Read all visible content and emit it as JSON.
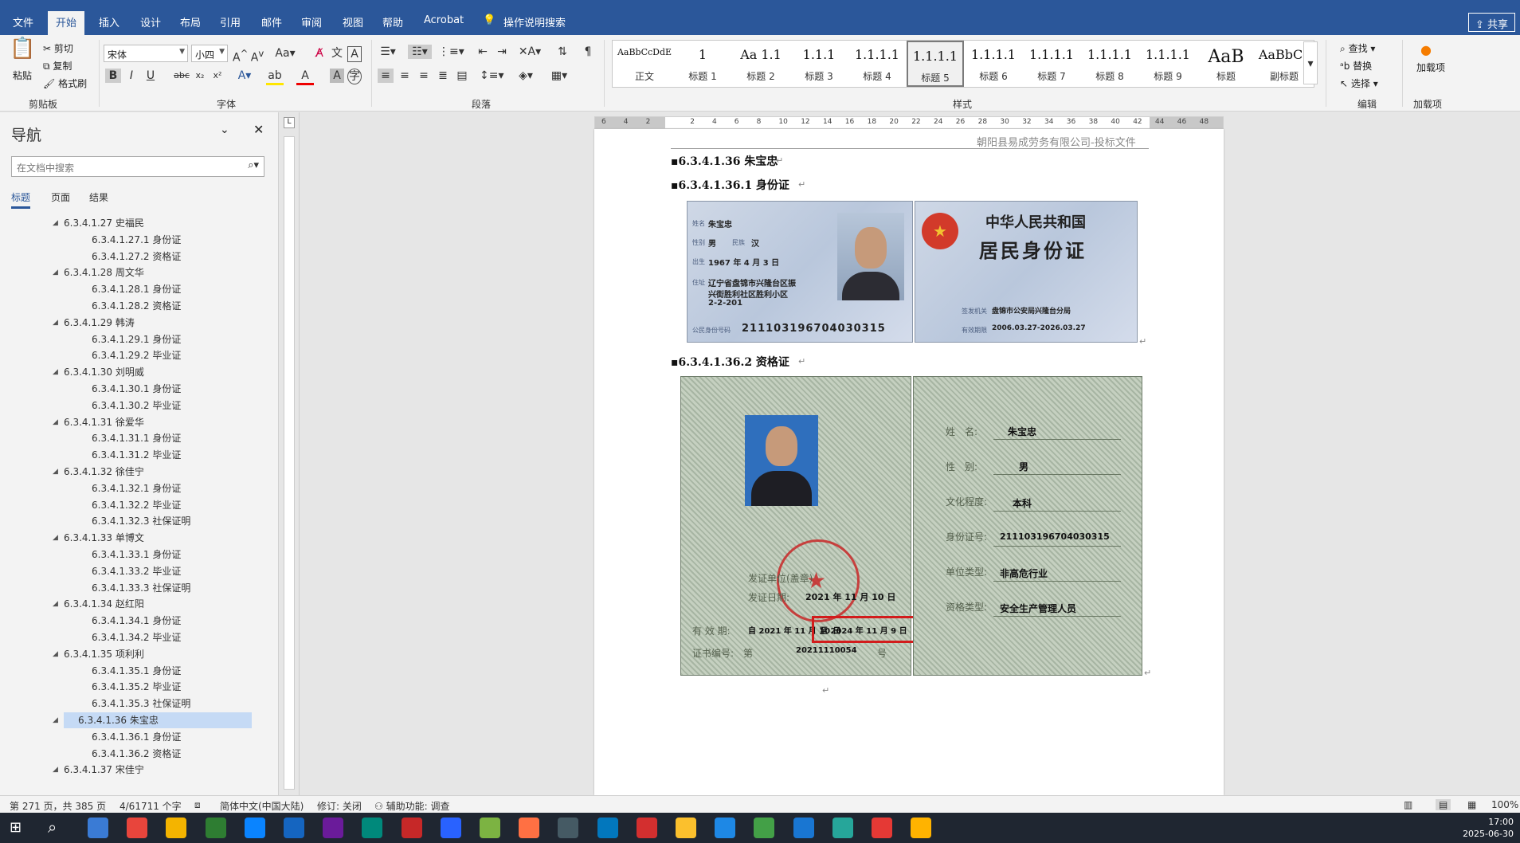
{
  "ribbon_tabs": [
    "文件",
    "开始",
    "插入",
    "设计",
    "布局",
    "引用",
    "邮件",
    "审阅",
    "视图",
    "帮助",
    "Acrobat"
  ],
  "active_tab": "开始",
  "tell_me": "操作说明搜索",
  "share": "共享",
  "clipboard": {
    "paste": "粘贴",
    "cut": "剪切",
    "copy": "复制",
    "format_painter": "格式刷",
    "group": "剪贴板"
  },
  "font": {
    "name": "宋体",
    "size": "小四",
    "group": "字体"
  },
  "paragraph_group": "段落",
  "styles": {
    "group": "样式",
    "items": [
      {
        "preview": "AaBbCcDdE",
        "name": "正文"
      },
      {
        "preview": "1",
        "name": "标题 1"
      },
      {
        "preview": "Aa 1.1",
        "name": "标题 2"
      },
      {
        "preview": "1.1.1",
        "name": "标题 3"
      },
      {
        "preview": "1.1.1.1",
        "name": "标题 4"
      },
      {
        "preview": "1.1.1.1",
        "name": "标题 5"
      },
      {
        "preview": "1.1.1.1",
        "name": "标题 6"
      },
      {
        "preview": "1.1.1.1",
        "name": "标题 7"
      },
      {
        "preview": "1.1.1.1",
        "name": "标题 8"
      },
      {
        "preview": "1.1.1.1",
        "name": "标题 9"
      },
      {
        "preview": "AaB",
        "name": "标题"
      },
      {
        "preview": "AaBbCc",
        "name": "副标题"
      }
    ],
    "selected": 5
  },
  "editing": {
    "find": "查找",
    "replace": "替换",
    "select": "选择",
    "group": "编辑"
  },
  "addins": {
    "label": "加载项",
    "group": "加载项"
  },
  "nav": {
    "title": "导航",
    "search_placeholder": "在文档中搜索",
    "tabs": [
      "标题",
      "页面",
      "结果"
    ],
    "items": [
      {
        "level": 4,
        "text": "6.3.4.1.27 史福民"
      },
      {
        "level": 5,
        "text": "6.3.4.1.27.1 身份证"
      },
      {
        "level": 5,
        "text": "6.3.4.1.27.2 资格证"
      },
      {
        "level": 4,
        "text": "6.3.4.1.28 周文华"
      },
      {
        "level": 5,
        "text": "6.3.4.1.28.1 身份证"
      },
      {
        "level": 5,
        "text": "6.3.4.1.28.2 资格证"
      },
      {
        "level": 4,
        "text": "6.3.4.1.29 韩涛"
      },
      {
        "level": 5,
        "text": "6.3.4.1.29.1 身份证"
      },
      {
        "level": 5,
        "text": "6.3.4.1.29.2 毕业证"
      },
      {
        "level": 4,
        "text": "6.3.4.1.30 刘明威"
      },
      {
        "level": 5,
        "text": "6.3.4.1.30.1 身份证"
      },
      {
        "level": 5,
        "text": "6.3.4.1.30.2 毕业证"
      },
      {
        "level": 4,
        "text": "6.3.4.1.31 徐爱华"
      },
      {
        "level": 5,
        "text": "6.3.4.1.31.1 身份证"
      },
      {
        "level": 5,
        "text": "6.3.4.1.31.2 毕业证"
      },
      {
        "level": 4,
        "text": "6.3.4.1.32 徐佳宁"
      },
      {
        "level": 5,
        "text": "6.3.4.1.32.1 身份证"
      },
      {
        "level": 5,
        "text": "6.3.4.1.32.2 毕业证"
      },
      {
        "level": 5,
        "text": "6.3.4.1.32.3 社保证明"
      },
      {
        "level": 4,
        "text": "6.3.4.1.33 单博文"
      },
      {
        "level": 5,
        "text": "6.3.4.1.33.1 身份证"
      },
      {
        "level": 5,
        "text": "6.3.4.1.33.2 毕业证"
      },
      {
        "level": 5,
        "text": "6.3.4.1.33.3 社保证明"
      },
      {
        "level": 4,
        "text": "6.3.4.1.34 赵红阳"
      },
      {
        "level": 5,
        "text": "6.3.4.1.34.1 身份证"
      },
      {
        "level": 5,
        "text": "6.3.4.1.34.2 毕业证"
      },
      {
        "level": 4,
        "text": "6.3.4.1.35 项利利"
      },
      {
        "level": 5,
        "text": "6.3.4.1.35.1 身份证"
      },
      {
        "level": 5,
        "text": "6.3.4.1.35.2 毕业证"
      },
      {
        "level": 5,
        "text": "6.3.4.1.35.3 社保证明"
      },
      {
        "level": 4,
        "text": "6.3.4.1.36 朱宝忠",
        "selected": true
      },
      {
        "level": 5,
        "text": "6.3.4.1.36.1 身份证"
      },
      {
        "level": 5,
        "text": "6.3.4.1.36.2 资格证"
      },
      {
        "level": 4,
        "text": "6.3.4.1.37 宋佳宁"
      }
    ]
  },
  "ruler_labels": [
    "6",
    "4",
    "2",
    "",
    "2",
    "4",
    "6",
    "8",
    "10",
    "12",
    "14",
    "16",
    "18",
    "20",
    "22",
    "24",
    "26",
    "28",
    "30",
    "32",
    "34",
    "36",
    "38",
    "40",
    "42",
    "44",
    "46",
    "48"
  ],
  "document": {
    "header": "朝阳县易成劳务有限公司-投标文件",
    "h1": "6.3.4.1.36 朱宝忠",
    "h2": "6.3.4.1.36.1  身份证",
    "h3": "6.3.4.1.36.2  资格证",
    "id_front": {
      "name_label": "姓名",
      "name": "朱宝忠",
      "sex_label": "性别",
      "sex": "男",
      "nation_label": "民族",
      "nation": "汉",
      "birth_label": "出生",
      "birth": "1967 年 4 月 3 日",
      "addr_label": "住址",
      "addr1": "辽宁省盘锦市兴隆台区振",
      "addr2": "兴街胜利社区胜利小区",
      "addr3": "2-2-201",
      "idno_label": "公民身份号码",
      "idno": "211103196704030315"
    },
    "id_back": {
      "line1": "中华人民共和国",
      "line2": "居民身份证",
      "authority_label": "签发机关",
      "authority": "盘锦市公安局兴隆台分局",
      "valid_label": "有效期限",
      "valid": "2006.03.27-2026.03.27"
    },
    "cert": {
      "name_label": "姓　名:",
      "name": "朱宝忠",
      "sex_label": "性　别:",
      "sex": "男",
      "edu_label": "文化程度:",
      "edu": "本科",
      "id_label": "身份证号:",
      "id": "211103196704030315",
      "unit_label": "单位类型:",
      "unit": "非高危行业",
      "type_label": "资格类型:",
      "type": "安全生产管理人员",
      "issuer_label": "发证单位(盖章)",
      "issue_date_label": "发证日期:",
      "issue_date": "2021 年 11 月 10 日",
      "valid_label": "有 效 期:",
      "valid_from": "自 2021 年 11 月 10 日",
      "valid_to": "至 2024 年 11 月 9 日",
      "certno_label": "证书编号:　第",
      "certno": "20211110054",
      "certno_suffix": "号"
    }
  },
  "status": {
    "page": "第 271 页，共 385 页",
    "words": "4/61711 个字",
    "lang": "简体中文(中国大陆)",
    "track": "修订: 关闭",
    "access": "辅助功能: 调查",
    "zoom": "100%"
  },
  "clock": {
    "time": "17:00",
    "date": "2025-06-30"
  },
  "colors": {
    "brand": "#2b579a",
    "selected_nav": "#c5daf5",
    "highlight_box": "#d21c1c"
  }
}
